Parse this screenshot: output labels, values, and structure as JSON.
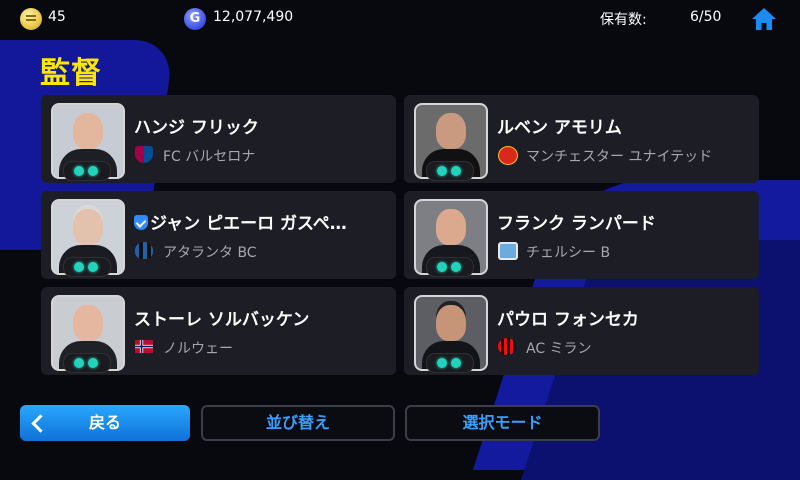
{
  "topbar": {
    "coins": "45",
    "gp": "12,077,490",
    "gp_icon_letter": "G",
    "owned_label": "保有数:",
    "owned_value": "6/50"
  },
  "page": {
    "title": "監督"
  },
  "managers": [
    {
      "name": "ハンジ フリック",
      "team": "FC バルセロナ",
      "verified": false,
      "team_icon": "barcelona-crest-icon",
      "accent": "#a50044"
    },
    {
      "name": "ルベン アモリム",
      "team": "マンチェスター ユナイテッド",
      "verified": false,
      "team_icon": "manutd-crest-icon",
      "accent": "#da291c"
    },
    {
      "name": "ジャン ピエーロ ガスペ…",
      "team": "アタランタ BC",
      "verified": true,
      "team_icon": "atalanta-crest-icon",
      "accent": "#1e62b0"
    },
    {
      "name": "フランク ランパード",
      "team": "チェルシー B",
      "verified": false,
      "team_icon": "chelsea-b-crest-icon",
      "accent": "#6cabdd"
    },
    {
      "name": "ストーレ ソルバッケン",
      "team": "ノルウェー",
      "verified": false,
      "team_icon": "norway-flag-icon",
      "accent": "#ba0c2f"
    },
    {
      "name": "パウロ フォンセカ",
      "team": "AC ミラン",
      "verified": false,
      "team_icon": "acmilan-crest-icon",
      "accent": "#fb090b"
    }
  ],
  "buttons": {
    "back": "戻る",
    "sort": "並び替え",
    "select_mode": "選択モード"
  },
  "colors": {
    "title": "#ffe600",
    "accent_blue": "#1b8cf0",
    "card_bg": "#1d1e25"
  }
}
